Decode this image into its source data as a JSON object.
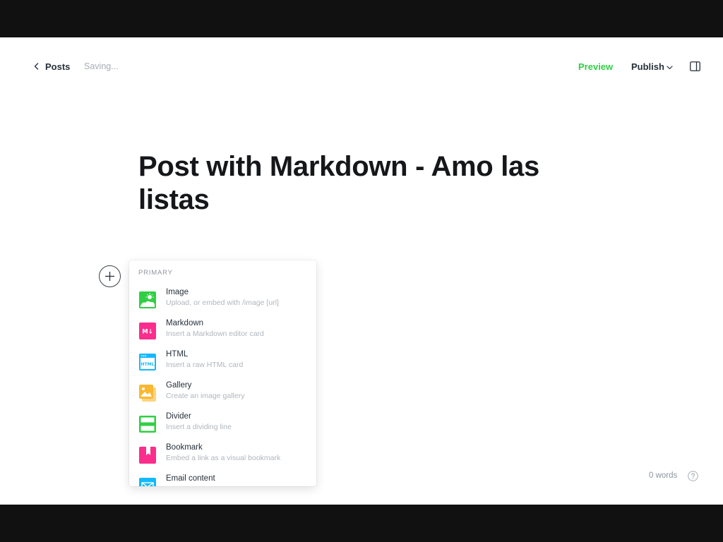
{
  "header": {
    "back_label": "Posts",
    "status": "Saving...",
    "preview_label": "Preview",
    "publish_label": "Publish"
  },
  "post": {
    "title": "Post with Markdown - Amo las listas"
  },
  "card_menu": {
    "section_label": "PRIMARY",
    "items": [
      {
        "name": "Image",
        "description": "Upload, or embed with /image [url]",
        "icon": "image-icon",
        "color": "#30cf43"
      },
      {
        "name": "Markdown",
        "description": "Insert a Markdown editor card",
        "icon": "markdown-icon",
        "color": "#fb2d8d"
      },
      {
        "name": "HTML",
        "description": "Insert a raw HTML card",
        "icon": "html-icon",
        "color": "#14b8ff"
      },
      {
        "name": "Gallery",
        "description": "Create an image gallery",
        "icon": "gallery-icon",
        "color": "#fcb831"
      },
      {
        "name": "Divider",
        "description": "Insert a dividing line",
        "icon": "divider-icon",
        "color": "#30cf43"
      },
      {
        "name": "Bookmark",
        "description": "Embed a link as a visual bookmark",
        "icon": "bookmark-icon",
        "color": "#fb2d8d"
      },
      {
        "name": "Email content",
        "description": "",
        "icon": "email-icon",
        "color": "#14b8ff"
      }
    ]
  },
  "footer": {
    "word_count": "0 words"
  },
  "colors": {
    "accent_green": "#30cf43",
    "text_dark": "#26303a",
    "muted": "#a5adb5"
  }
}
